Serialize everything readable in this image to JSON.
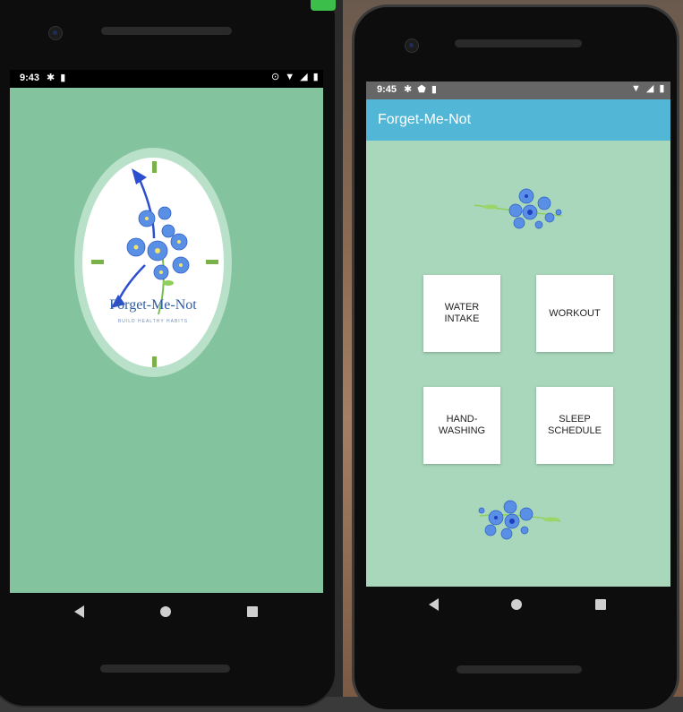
{
  "splash": {
    "status_time": "9:43",
    "logo_title": "Forget-Me-Not",
    "logo_subtitle": "BUILD HEALTHY HABITS",
    "bg_color": "#83c49f"
  },
  "home": {
    "status_time": "9:45",
    "app_title": "Forget-Me-Not",
    "appbar_color": "#52b6d6",
    "bg_color": "#a9d7bb",
    "tiles": [
      {
        "label": "WATER INTAKE"
      },
      {
        "label": "WORKOUT"
      },
      {
        "label": "HAND-WASHING"
      },
      {
        "label": "SLEEP SCHEDULE"
      }
    ]
  },
  "icons": {
    "settings": "gear-icon",
    "sd_card": "sd-card-icon",
    "location": "location-icon",
    "wifi": "wifi-icon",
    "signal": "signal-icon",
    "battery": "battery-icon",
    "shield": "shield-icon",
    "back": "back-icon",
    "home": "home-icon",
    "recent": "recent-apps-icon"
  }
}
